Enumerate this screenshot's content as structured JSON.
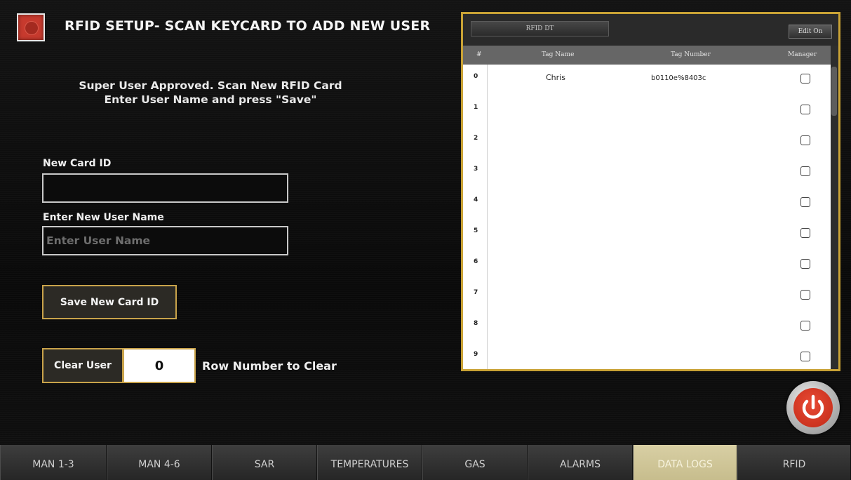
{
  "header": {
    "title": "RFID SETUP- SCAN KEYCARD TO ADD NEW USER"
  },
  "instructions": {
    "line1": "Super User Approved.  Scan New RFID Card",
    "line2": "Enter User Name and press \"Save\""
  },
  "form": {
    "card_id_label": "New Card ID",
    "card_id_value": "",
    "user_name_label": "Enter New User Name",
    "user_name_placeholder": "Enter User Name",
    "save_button": "Save New Card ID",
    "clear_button": "Clear User",
    "row_number_value": "0",
    "row_number_label": "Row Number to Clear"
  },
  "table": {
    "tab_label": "RFID DT",
    "edit_button": "Edit On",
    "columns": [
      "#",
      "Tag Name",
      "Tag Number",
      "Manager"
    ],
    "rows": [
      {
        "index": "0",
        "name": "Chris",
        "tag": "b0110e%8403c",
        "manager": false
      },
      {
        "index": "1",
        "name": "",
        "tag": "",
        "manager": false
      },
      {
        "index": "2",
        "name": "",
        "tag": "",
        "manager": false
      },
      {
        "index": "3",
        "name": "",
        "tag": "",
        "manager": false
      },
      {
        "index": "4",
        "name": "",
        "tag": "",
        "manager": false
      },
      {
        "index": "5",
        "name": "",
        "tag": "",
        "manager": false
      },
      {
        "index": "6",
        "name": "",
        "tag": "",
        "manager": false
      },
      {
        "index": "7",
        "name": "",
        "tag": "",
        "manager": false
      },
      {
        "index": "8",
        "name": "",
        "tag": "",
        "manager": false
      },
      {
        "index": "9",
        "name": "",
        "tag": "",
        "manager": false
      }
    ]
  },
  "nav": {
    "tabs": [
      "MAN 1-3",
      "MAN 4-6",
      "SAR",
      "TEMPERATURES",
      "GAS",
      "ALARMS",
      "DATA LOGS",
      "RFID"
    ],
    "active": "DATA LOGS"
  },
  "icons": {
    "header": "rfid-icon",
    "power": "power-icon",
    "annotation": "arrow-icon"
  },
  "colors": {
    "accent_gold": "#c9a34a",
    "power_red": "#d93a26",
    "active_tab": "#d8cfa4"
  }
}
